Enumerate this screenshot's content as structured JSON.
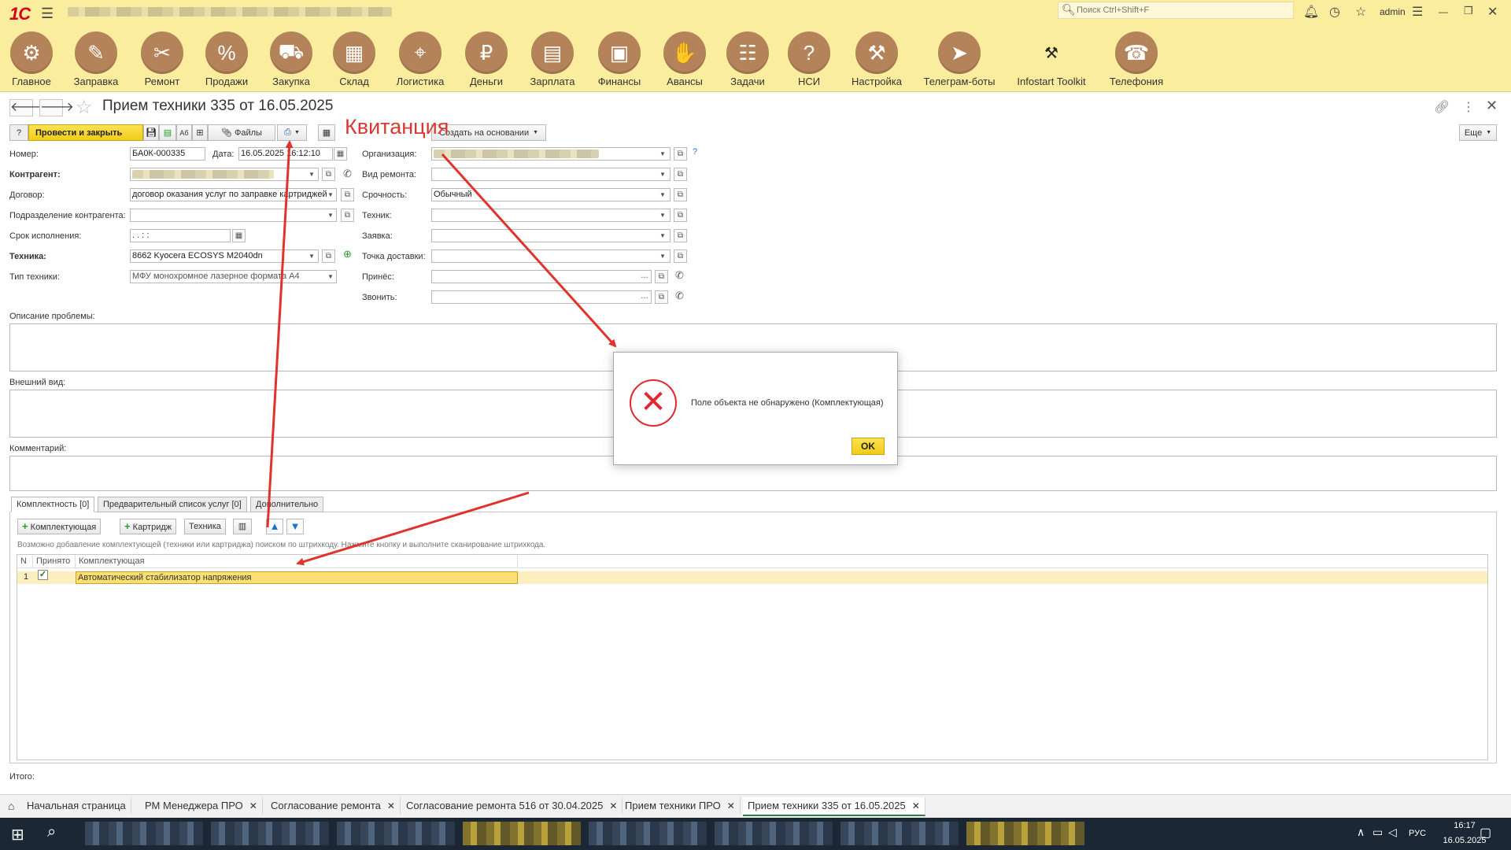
{
  "topbar": {
    "search_placeholder": "Поиск Ctrl+Shift+F",
    "user": "admin"
  },
  "sections": [
    {
      "label": "Главное",
      "icon": "gears-icon"
    },
    {
      "label": "Заправка",
      "icon": "cartridge-icon"
    },
    {
      "label": "Ремонт",
      "icon": "tools-icon"
    },
    {
      "label": "Продажи",
      "icon": "sale-icon"
    },
    {
      "label": "Закупка",
      "icon": "cart-icon"
    },
    {
      "label": "Склад",
      "icon": "boxes-icon"
    },
    {
      "label": "Логистика",
      "icon": "map-icon"
    },
    {
      "label": "Деньги",
      "icon": "money-bag-icon"
    },
    {
      "label": "Зарплата",
      "icon": "wallet-icon"
    },
    {
      "label": "Финансы",
      "icon": "briefcase-icon"
    },
    {
      "label": "Авансы",
      "icon": "hand-money-icon"
    },
    {
      "label": "Задачи",
      "icon": "tasks-icon"
    },
    {
      "label": "НСИ",
      "icon": "reference-icon"
    },
    {
      "label": "Настройка",
      "icon": "settings-icon"
    },
    {
      "label": "Телеграм-боты",
      "icon": "telegram-icon"
    },
    {
      "label": "Infostart Toolkit",
      "icon": "toolkit-icon"
    },
    {
      "label": "Телефония",
      "icon": "phone-icon"
    }
  ],
  "form": {
    "title": "Прием техники 335 от 16.05.2025",
    "toolbar": {
      "help": "?",
      "post_close": "Провести и закрыть",
      "ab": "Аб",
      "files": "Файлы",
      "create_based": "Создать на основании",
      "more": "Еще"
    },
    "annotation": "Квитанция",
    "fields": {
      "number_label": "Номер:",
      "number_value": "БА0К-000335",
      "date_label": "Дата:",
      "date_value": "16.05.2025 16:12:10",
      "org_label": "Организация:",
      "counterparty_label": "Контрагент:",
      "repair_type_label": "Вид ремонта:",
      "contract_label": "Договор:",
      "contract_value": "договор оказания услуг по заправке картриджей",
      "urgency_label": "Срочность:",
      "urgency_value": "Обычный",
      "division_label": "Подразделение контрагента:",
      "technician_label": "Техник:",
      "deadline_label": "Срок исполнения:",
      "deadline_value": " .  .      :  :",
      "request_label": "Заявка:",
      "equipment_label": "Техника:",
      "equipment_value": "8662 Kyocera ECOSYS M2040dn",
      "delivery_label": "Точка доставки:",
      "equipment_type_label": "Тип техники:",
      "equipment_type_value": "МФУ монохромное лазерное формата А4",
      "brought_label": "Принёс:",
      "call_label": "Звонить:",
      "dots": "..."
    },
    "problem_label": "Описание проблемы:",
    "appearance_label": "Внешний вид:",
    "comment_label": "Комментарий:",
    "tabs": [
      "Комплектность [0]",
      "Предварительный список услуг [0]",
      "Дополнительно"
    ],
    "tab_buttons": {
      "component": "Комплектующая",
      "cartridge": "Картридж",
      "equipment": "Техника"
    },
    "hint": "Возможно добавление комплектующей (техники или картриджа) поиском по штрихкоду. Нажмите кнопку и выполните сканирование штрихкода.",
    "table": {
      "headers": [
        "N",
        "Принято",
        "Комплектующая"
      ],
      "rows": [
        {
          "n": "1",
          "accepted": true,
          "component": "Автоматический стабилизатор напряжения"
        }
      ]
    },
    "total_label": "Итого:"
  },
  "modal": {
    "message": "Поле объекта не обнаружено (Комплектующая)",
    "ok": "OK"
  },
  "bottom_tabs": [
    {
      "label": "Начальная страница",
      "closable": false
    },
    {
      "label": "РМ Менеджера ПРО",
      "closable": true
    },
    {
      "label": "Согласование ремонта",
      "closable": true
    },
    {
      "label": "Согласование ремонта 516 от 30.04.2025",
      "closable": true
    },
    {
      "label": "Прием техники ПРО",
      "closable": true
    },
    {
      "label": "Прием техники 335 от 16.05.2025",
      "closable": true,
      "active": true
    }
  ],
  "taskbar": {
    "lang": "РУС",
    "time": "16:17",
    "date": "16.05.2025"
  },
  "colors": {
    "topbar": "#fbed9e",
    "section_icon": "#b5835a",
    "accent_button": "#f2cc18",
    "annotation": "#d83a32",
    "error": "#e0282e"
  }
}
